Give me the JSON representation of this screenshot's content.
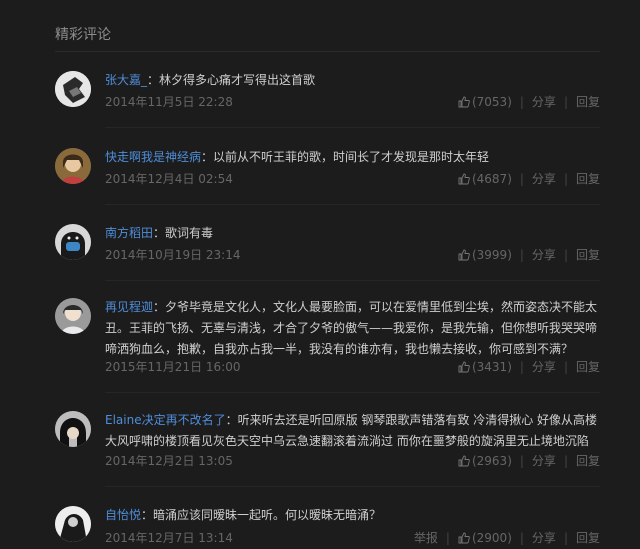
{
  "section": {
    "title": "精彩评论"
  },
  "comments": [
    {
      "user": "张大嘉_",
      "text": "林夕得多心痛才写得出这首歌",
      "time": "2014年11月5日 22:28",
      "likes": "(7053)",
      "share": "分享",
      "reply": "回复",
      "avatar": "avatar-dark-figure"
    },
    {
      "user": "快走啊我是神经病",
      "text": "以前从不听王菲的歌，时间长了才发现是那时太年轻",
      "time": "2014年12月4日 02:54",
      "likes": "(4687)",
      "share": "分享",
      "reply": "回复",
      "avatar": "avatar-girl-portrait"
    },
    {
      "user": "南方稻田",
      "text": "歌词有毒",
      "time": "2014年10月19日 23:14",
      "likes": "(3999)",
      "share": "分享",
      "reply": "回复",
      "avatar": "avatar-masked-person"
    },
    {
      "user": "再见程迦",
      "text": "夕爷毕竟是文化人，文化人最要脸面，可以在爱情里低到尘埃，然而姿态决不能太丑。王菲的飞扬、无辜与清浅，才合了夕爷的傲气——我爱你，是我先输，但你想听我哭哭啼啼洒狗血么，抱歉，自我亦占我一半，我没有的谁亦有，我也懒去接收，你可感到不满？",
      "time": "2015年11月21日 16:00",
      "likes": "(3431)",
      "share": "分享",
      "reply": "回复",
      "avatar": "avatar-light-portrait"
    },
    {
      "user": "Elaine决定再不改名了",
      "text": "听来听去还是听回原版 钢琴跟歌声错落有致 冷清得揪心 好像从高楼大风呼啸的楼顶看见灰色天空中乌云急速翻滚着流淌过 而你在噩梦般的旋涡里无止境地沉陷",
      "time": "2014年12月2日 13:05",
      "likes": "(2963)",
      "share": "分享",
      "reply": "回复",
      "avatar": "avatar-dark-hair-face"
    },
    {
      "user": "自怡悦",
      "text": "暗涌应该同暧昧一起听。何以暧昧无暗涌？",
      "time": "2014年12月7日 13:14",
      "report": "举报",
      "likes": "(2900)",
      "share": "分享",
      "reply": "回复",
      "avatar": "avatar-bw-photo"
    }
  ]
}
